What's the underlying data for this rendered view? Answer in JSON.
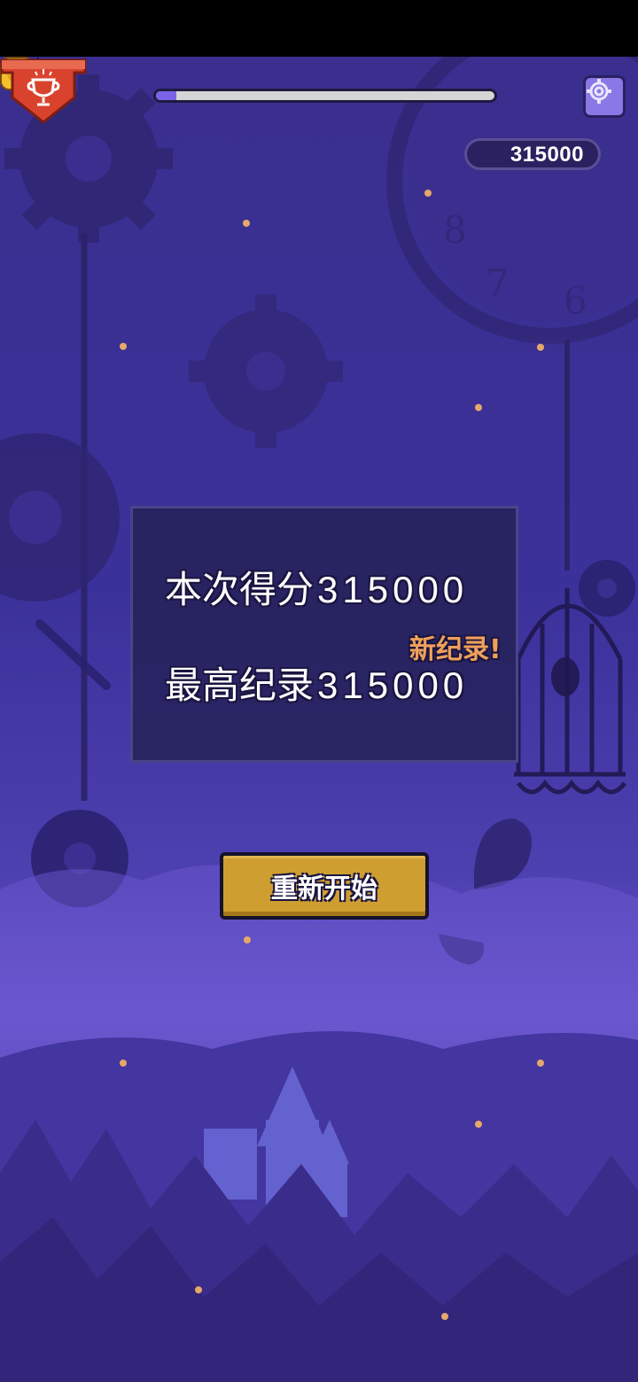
{
  "hud": {
    "progress_fraction": 0.06,
    "coins": "315000",
    "settings_icon": "gear-icon",
    "coin_icon": "gold-coin-icon",
    "progress_marker_icon": "black-cat-icon"
  },
  "result": {
    "current_score_label": "本次得分",
    "current_score": "315000",
    "best_score_label": "最高纪录",
    "best_score": "315000",
    "new_record_text": "新纪录!",
    "badge_icon": "trophy-icon"
  },
  "restart_button": {
    "label": "重新开始"
  },
  "colors": {
    "background": "#3a2f8e",
    "panel": "#26225a",
    "accent_gold": "#cf9e30",
    "new_record": "#f0a05a",
    "badge_red": "#d9432e"
  }
}
